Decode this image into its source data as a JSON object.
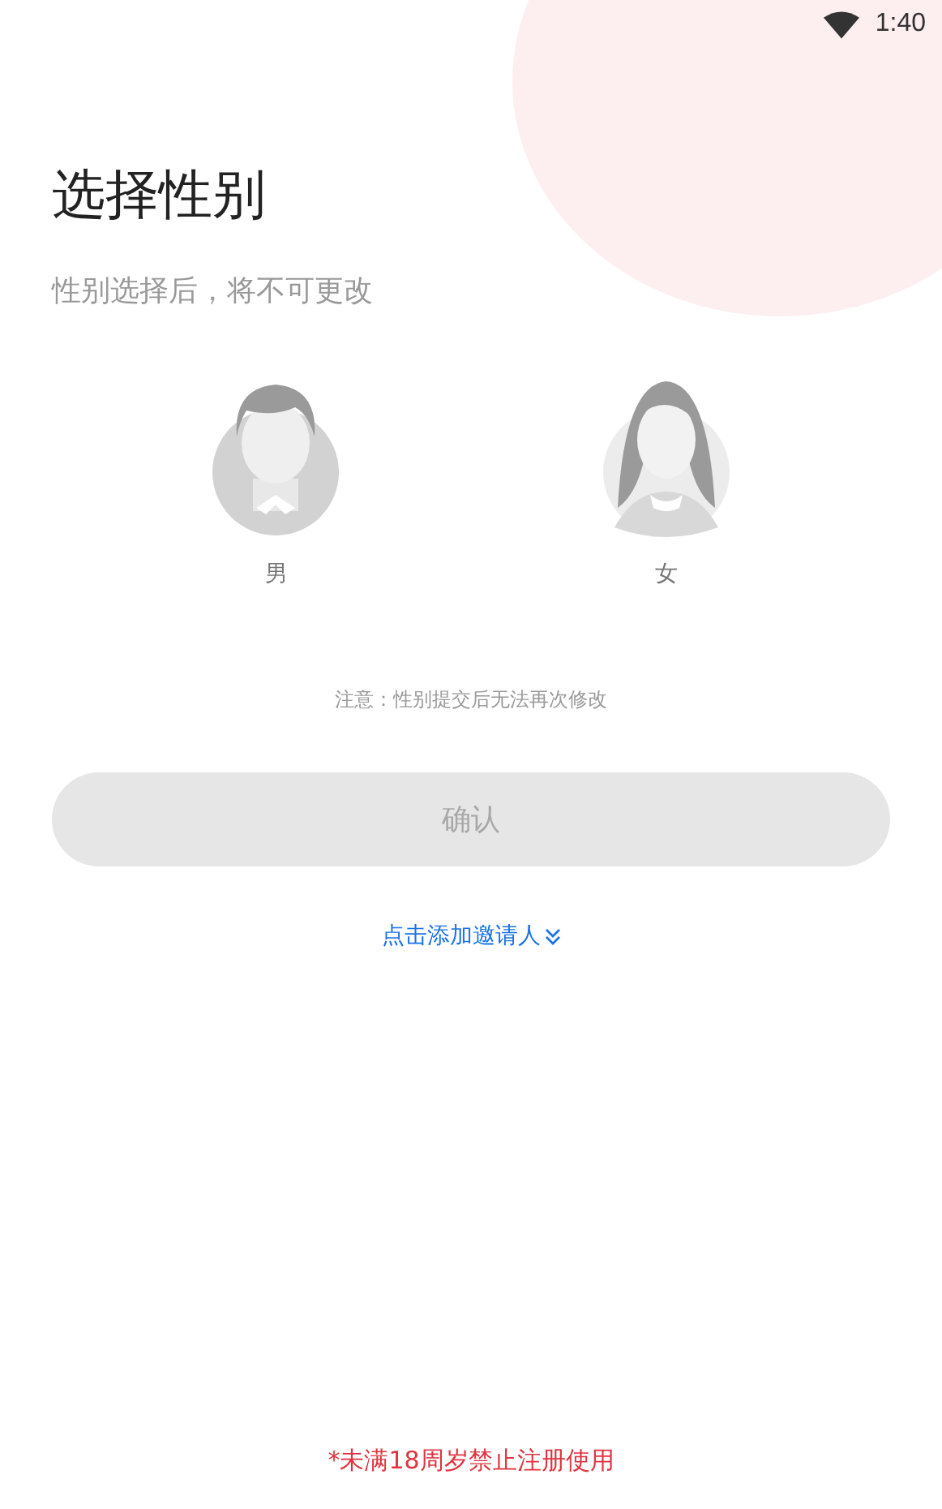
{
  "status_bar": {
    "time": "1:40"
  },
  "title": "选择性别",
  "subtitle": "性别选择后，将不可更改",
  "genders": [
    {
      "kind": "male",
      "label": "男",
      "selected": false
    },
    {
      "kind": "female",
      "label": "女",
      "selected": false
    }
  ],
  "note": "注意：性别提交后无法再次修改",
  "confirm_button": {
    "label": "确认",
    "disabled": true
  },
  "invite_link": "点击添加邀请人",
  "footer_warning": "*未满18周岁禁止注册使用"
}
